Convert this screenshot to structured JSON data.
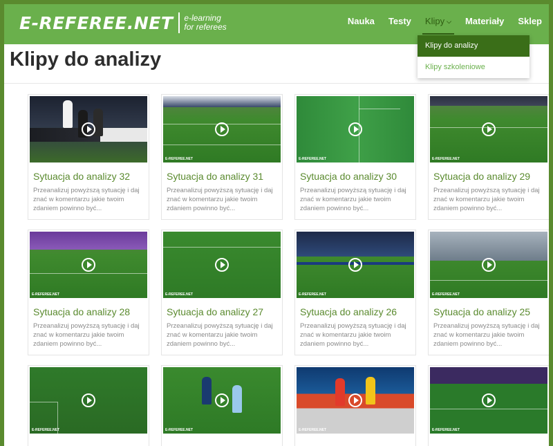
{
  "header": {
    "logo_main": "E-REFEREE.NET",
    "logo_sub_line1": "e-learning",
    "logo_sub_line2": "for referees",
    "nav": [
      "Nauka",
      "Testy",
      "Klipy",
      "Materiały",
      "Sklep"
    ],
    "active_nav": "Klipy",
    "dropdown": [
      "Klipy do analizy",
      "Klipy szkoleniowe"
    ],
    "dropdown_selected": "Klipy do analizy"
  },
  "page": {
    "title": "Klipy do analizy"
  },
  "colors": {
    "brand_green": "#6ab04c",
    "dark_green": "#3a6e18",
    "title_green": "#5a8a2e"
  },
  "cards": [
    {
      "title": "Sytuacja do analizy 32",
      "desc": "Przeanalizuj powyższą sytuację i daj znać w komentarzu jakie twoim zdaniem powinno być..."
    },
    {
      "title": "Sytuacja do analizy 31",
      "desc": "Przeanalizuj powyższą sytuację i daj znać w komentarzu jakie twoim zdaniem powinno być..."
    },
    {
      "title": "Sytuacja do analizy 30",
      "desc": "Przeanalizuj powyższą sytuację i daj znać w komentarzu jakie twoim zdaniem powinno być..."
    },
    {
      "title": "Sytuacja do analizy 29",
      "desc": "Przeanalizuj powyższą sytuację i daj znać w komentarzu jakie twoim zdaniem powinno być..."
    },
    {
      "title": "Sytuacja do analizy 28",
      "desc": "Przeanalizuj powyższą sytuację i daj znać w komentarzu jakie twoim zdaniem powinno być..."
    },
    {
      "title": "Sytuacja do analizy 27",
      "desc": "Przeanalizuj powyższą sytuację i daj znać w komentarzu jakie twoim zdaniem powinno być..."
    },
    {
      "title": "Sytuacja do analizy 26",
      "desc": "Przeanalizuj powyższą sytuację i daj znać w komentarzu jakie twoim zdaniem powinno być..."
    },
    {
      "title": "Sytuacja do analizy 25",
      "desc": "Przeanalizuj powyższą sytuację i daj znać w komentarzu jakie twoim zdaniem powinno być..."
    }
  ],
  "thumb_watermark": "E-REFEREE.NET",
  "play_icon": "play-circle-icon"
}
